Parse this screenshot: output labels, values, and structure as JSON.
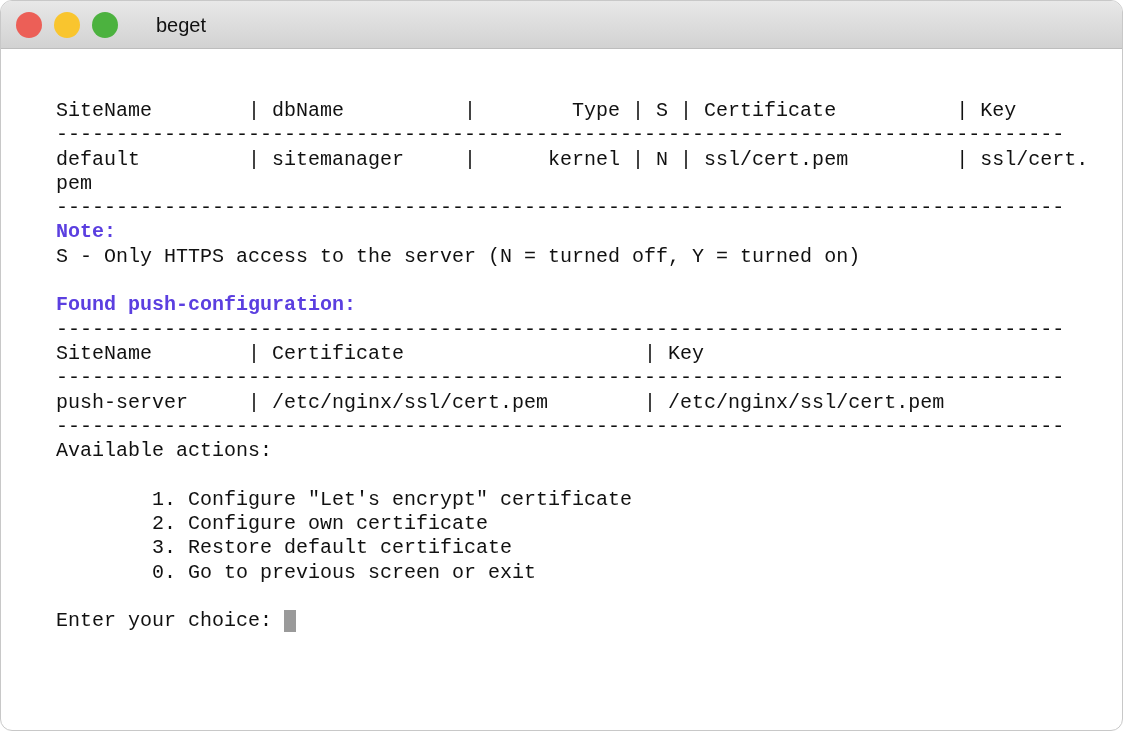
{
  "window": {
    "title": "beget"
  },
  "lines": [
    {
      "kind": "text",
      "text": "SiteName        | dbName          |        Type | S | Certificate          | Key"
    },
    {
      "kind": "text",
      "text": "------------------------------------------------------------------------------------"
    },
    {
      "kind": "text",
      "text": "default         | sitemanager     |      kernel | N | ssl/cert.pem         | ssl/cert."
    },
    {
      "kind": "text",
      "text": "pem"
    },
    {
      "kind": "text",
      "text": "------------------------------------------------------------------------------------"
    },
    {
      "kind": "heading",
      "text": "Note:"
    },
    {
      "kind": "text",
      "text": "S - Only HTTPS access to the server (N = turned off, Y = turned on)"
    },
    {
      "kind": "blank"
    },
    {
      "kind": "heading",
      "text": "Found push-configuration:"
    },
    {
      "kind": "text",
      "text": "------------------------------------------------------------------------------------"
    },
    {
      "kind": "text",
      "text": "SiteName        | Certificate                    | Key"
    },
    {
      "kind": "text",
      "text": "------------------------------------------------------------------------------------"
    },
    {
      "kind": "text",
      "text": "push-server     | /etc/nginx/ssl/cert.pem        | /etc/nginx/ssl/cert.pem"
    },
    {
      "kind": "text",
      "text": "------------------------------------------------------------------------------------"
    },
    {
      "kind": "text",
      "text": "Available actions:"
    },
    {
      "kind": "blank"
    },
    {
      "kind": "text",
      "text": "        1. Configure \"Let's encrypt\" certificate"
    },
    {
      "kind": "text",
      "text": "        2. Configure own certificate"
    },
    {
      "kind": "text",
      "text": "        3. Restore default certificate"
    },
    {
      "kind": "text",
      "text": "        0. Go to previous screen or exit"
    },
    {
      "kind": "blank"
    },
    {
      "kind": "prompt",
      "text": "Enter your choice: "
    }
  ]
}
